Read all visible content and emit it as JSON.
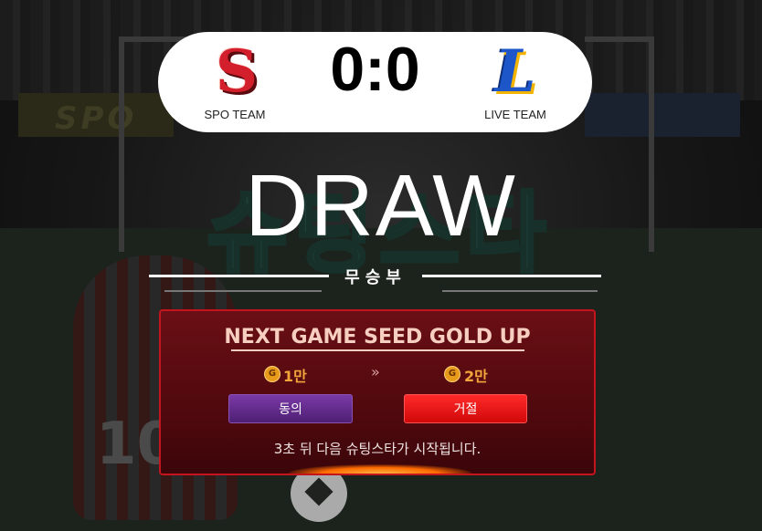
{
  "scoreboard": {
    "home_team": "SPO TEAM",
    "away_team": "LIVE TEAM",
    "home_logo_letter": "S",
    "away_logo_letter": "L",
    "score": "0:0"
  },
  "result": {
    "headline": "DRAW",
    "subtitle": "무승부"
  },
  "panel": {
    "title": "NEXT GAME SEED GOLD UP",
    "coin_glyph": "G",
    "current_seed": "1만",
    "arrow": "»",
    "next_seed": "2만",
    "agree_label": "동의",
    "decline_label": "거절",
    "countdown_text": "3초 뒤 다음 슈팅스타가 시작됩니다."
  },
  "colors": {
    "panel_bg": "#5a0b10",
    "panel_border": "#c4141e",
    "gold_text": "#f2a53b",
    "agree_button": "#5a2585",
    "decline_button": "#e01010",
    "home_logo": "#d21f2b",
    "away_logo": "#1c56c8"
  },
  "background": {
    "banner_text": "SPO",
    "game_logo": "슈팅스타",
    "player_number": "10"
  }
}
